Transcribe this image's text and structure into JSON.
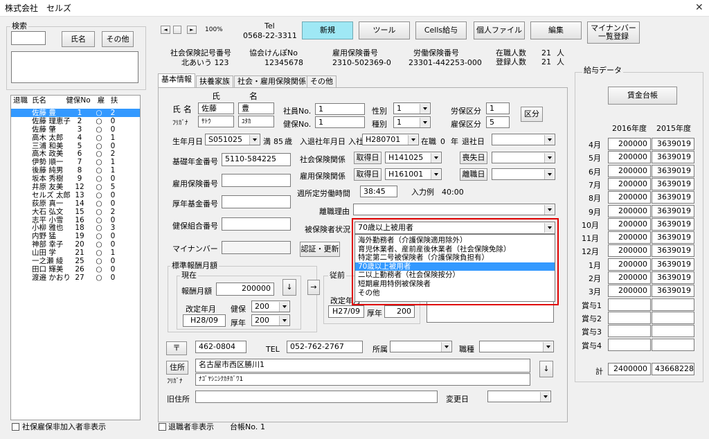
{
  "window": {
    "title": "株式会社　セルズ",
    "close": "✕"
  },
  "search": {
    "group": "検索",
    "name_btn": "氏名",
    "other_btn": "その他"
  },
  "list": {
    "headers": [
      "退職",
      "氏名",
      "健保No",
      "雇",
      "扶"
    ],
    "rows": [
      {
        "name": "佐藤 豊",
        "no": "1",
        "emp": "○",
        "dep": "2"
      },
      {
        "name": "佐藤 理恵子",
        "no": "2",
        "emp": "○",
        "dep": "0"
      },
      {
        "name": "佐藤 肇",
        "no": "3",
        "emp": "○",
        "dep": "0"
      },
      {
        "name": "高木 太郎",
        "no": "4",
        "emp": "○",
        "dep": "1"
      },
      {
        "name": "三浦 和美",
        "no": "5",
        "emp": "○",
        "dep": "0"
      },
      {
        "name": "高木 政美",
        "no": "6",
        "emp": "○",
        "dep": "2"
      },
      {
        "name": "伊勢 順一",
        "no": "7",
        "emp": "○",
        "dep": "1"
      },
      {
        "name": "後藤 純男",
        "no": "8",
        "emp": "○",
        "dep": "1"
      },
      {
        "name": "坂本 秀樹",
        "no": "9",
        "emp": "○",
        "dep": "0"
      },
      {
        "name": "井原 友美",
        "no": "12",
        "emp": "○",
        "dep": "5"
      },
      {
        "name": "セルズ 太郎",
        "no": "13",
        "emp": "○",
        "dep": "0"
      },
      {
        "name": "荻原 真一",
        "no": "14",
        "emp": "○",
        "dep": "0"
      },
      {
        "name": "大石 弘文",
        "no": "15",
        "emp": "○",
        "dep": "2"
      },
      {
        "name": "志平 小雪",
        "no": "16",
        "emp": "○",
        "dep": "0"
      },
      {
        "name": "小柳 雅也",
        "no": "18",
        "emp": "○",
        "dep": "3"
      },
      {
        "name": "内野 猛",
        "no": "19",
        "emp": "○",
        "dep": "0"
      },
      {
        "name": "神部 幸子",
        "no": "20",
        "emp": "○",
        "dep": "0"
      },
      {
        "name": "山田 学",
        "no": "21",
        "emp": "○",
        "dep": "1"
      },
      {
        "name": "一之瀬 綾",
        "no": "25",
        "emp": "○",
        "dep": "0"
      },
      {
        "name": "田口 輝美",
        "no": "26",
        "emp": "○",
        "dep": "0"
      },
      {
        "name": "渡邉 かおり",
        "no": "27",
        "emp": "○",
        "dep": "0"
      }
    ]
  },
  "nav": {
    "first": "|◄",
    "prev": "◄",
    "next": "►|",
    "zoom": "100%"
  },
  "tel": {
    "label": "Tel",
    "number": "0568-22-3311"
  },
  "toolbar": {
    "new": "新規",
    "tool": "ツール",
    "cells": "Cells給与",
    "personal": "個人ファイル",
    "edit": "編集",
    "mynumber": "マイナンバー\n一覧登録"
  },
  "company": {
    "social_label": "社会保険記号番号",
    "social_value": "北あいう 123",
    "kenpo_label": "協会けんぽNo",
    "kenpo_value": "12345678",
    "employ_label": "雇用保険番号",
    "employ_value": "2310-502369-0",
    "labor_label": "労働保険番号",
    "labor_value": "23301-442253-000",
    "staff_label": "在職人数",
    "staff_value": "21",
    "reg_label": "登録人数",
    "reg_value": "21",
    "unit": "人"
  },
  "tabs": [
    "基本情報",
    "扶養家族",
    "社会・雇用保険関係",
    "その他"
  ],
  "basic": {
    "sei": "氏",
    "mei": "名",
    "name_label": "氏 名",
    "name_sei": "佐藤",
    "name_mei": "豊",
    "kana_label": "ﾌﾘｶﾞﾅ",
    "kana_sei": "ｻﾄｳ",
    "kana_mei": "ﾕﾀｶ",
    "empno_label": "社員No.",
    "empno": "1",
    "kenpo_label": "健保No.",
    "kenpo": "1",
    "gender_label": "性別",
    "gender": "1",
    "kind_label": "種別",
    "kind": "1",
    "labor_label": "労保区分",
    "labor": "1",
    "employ_label": "雇保区分",
    "employ": "5",
    "kubun_btn": "区分",
    "birth_label": "生年月日",
    "birth": "S051025",
    "age_prefix": "満",
    "age": "85",
    "age_suffix": "歳",
    "join_label": "入退社年月日",
    "join_prefix": "入社",
    "join": "H280701",
    "inservice": "在職",
    "years": "0",
    "years_suffix": "年",
    "leave_label": "退社日",
    "pension_label": "基礎年金番号",
    "pension": "5110-584225",
    "social_label": "社会保険関係",
    "social_get": "取得日",
    "social_date": "H141025",
    "social_loss": "喪失日",
    "employ_rel_label": "雇用保険関係",
    "employ_get": "取得日",
    "employ_date": "H161001",
    "employ_leave": "離職日",
    "employ_no_label": "雇用保険番号",
    "hours_label": "週所定労働時間",
    "hours": "38:45",
    "hours_example": "入力例　40:00",
    "fund_label": "厚年基金番号",
    "leave_reason_label": "離職理由",
    "union_label": "健保組合番号",
    "insured_label": "被保険者状況",
    "insured": "70歳以上被用者",
    "mynumber_label": "マイナンバー",
    "auth_btn": "認証・更新"
  },
  "dropdown": {
    "items": [
      "海外勤務者（介護保険適用除外）",
      "育児休業者、産前産後休業者（社会保険免除）",
      "特定第二号被保険者（介護保険負担有）",
      "70歳以上被用者",
      "二以上勤務者（社会保険按分）",
      "短期雇用特例被保険者",
      "その他"
    ],
    "selected": 3
  },
  "standard": {
    "group": "標準報酬月額",
    "current": "現在",
    "prev": "従前",
    "monthly_label": "報酬月額",
    "monthly": "200000",
    "revised_label": "改定年月",
    "revised": "H28/09",
    "health_label": "健保",
    "health": "200",
    "pension_label": "厚年",
    "pension": "200",
    "prev_revised": "H27/09",
    "prev_pension_label": "厚年",
    "prev_pension": "200",
    "down_arrow": "↓",
    "right_arrow": "→"
  },
  "address": {
    "postal_btn": "〒",
    "postal": "462-0804",
    "tel_label": "TEL",
    "tel": "052-762-2767",
    "dept_label": "所属",
    "job_label": "職種",
    "addr_btn": "住所",
    "address": "名古屋市西区勝川1",
    "kana_label": "ﾌﾘｶﾞﾅ",
    "kana": "ﾅｺﾞﾔｼﾆｼｸｶﾁｶﾞﾜ1",
    "old_label": "旧住所",
    "change_label": "変更日",
    "down_arrow": "↓"
  },
  "salary": {
    "group": "給与データ",
    "ledger_btn": "賃金台帳",
    "year1": "2016年度",
    "year2": "2015年度",
    "months": [
      {
        "m": "4月",
        "a": "200000",
        "b": "3639019"
      },
      {
        "m": "5月",
        "a": "200000",
        "b": "3639019"
      },
      {
        "m": "6月",
        "a": "200000",
        "b": "3639019"
      },
      {
        "m": "7月",
        "a": "200000",
        "b": "3639019"
      },
      {
        "m": "8月",
        "a": "200000",
        "b": "3639019"
      },
      {
        "m": "9月",
        "a": "200000",
        "b": "3639019"
      },
      {
        "m": "10月",
        "a": "200000",
        "b": "3639019"
      },
      {
        "m": "11月",
        "a": "200000",
        "b": "3639019"
      },
      {
        "m": "12月",
        "a": "200000",
        "b": "3639019"
      },
      {
        "m": "1月",
        "a": "200000",
        "b": "3639019"
      },
      {
        "m": "2月",
        "a": "200000",
        "b": "3639019"
      },
      {
        "m": "3月",
        "a": "200000",
        "b": "3639019"
      },
      {
        "m": "賞与1",
        "a": "",
        "b": ""
      },
      {
        "m": "賞与2",
        "a": "",
        "b": ""
      },
      {
        "m": "賞与3",
        "a": "",
        "b": ""
      },
      {
        "m": "賞与4",
        "a": "",
        "b": ""
      }
    ],
    "total_label": "計",
    "total_a": "2400000",
    "total_b": "43668228"
  },
  "footer": {
    "hide_insured": "社保雇保非加入者非表示",
    "hide_retired": "退職者非表示",
    "ledger_label": "台帳No.",
    "ledger_no": "1"
  },
  "colors": {
    "highlight": "#3399ff",
    "accent_button": "#9fe8f5",
    "dropdown_border": "#e00000"
  }
}
